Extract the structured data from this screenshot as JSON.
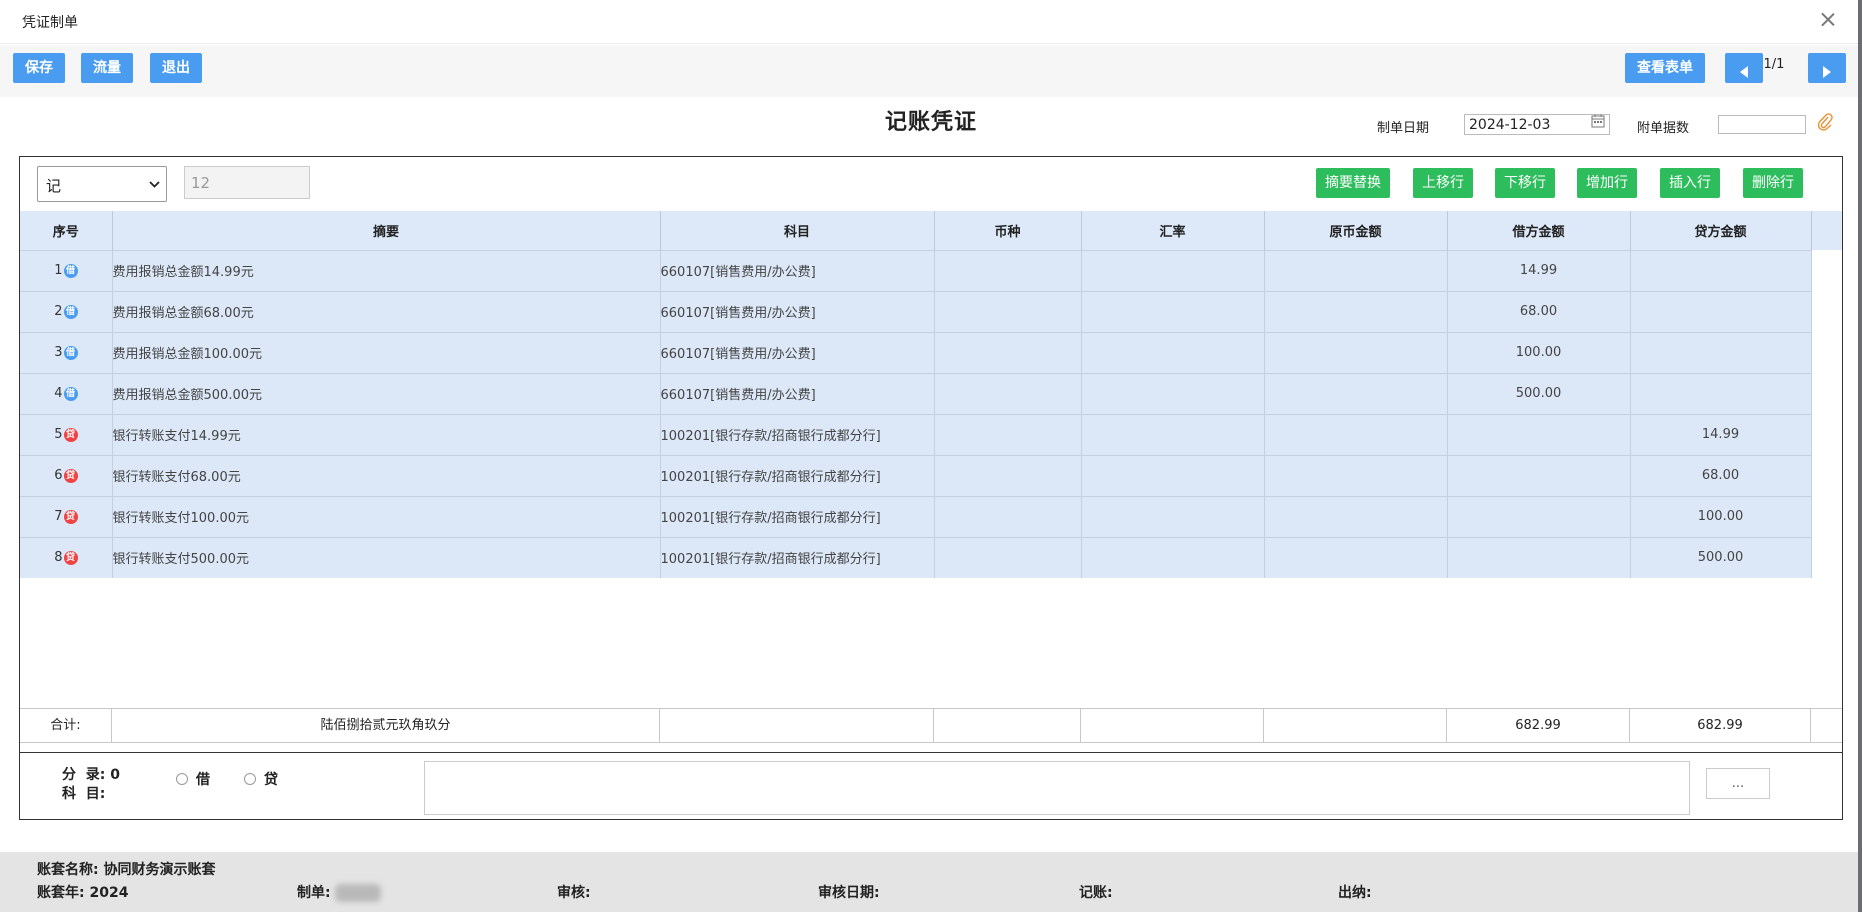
{
  "window": {
    "title": "凭证制单"
  },
  "toolbar": {
    "save": "保存",
    "flow": "流量",
    "exit": "退出",
    "view_sheet": "查看表单",
    "page": "1/1"
  },
  "header": {
    "voucher_title": "记账凭证",
    "date_label": "制单日期",
    "date_value": "2024-12-03",
    "attach_label": "附单据数",
    "attach_value": ""
  },
  "voucher_type": {
    "selected": "记"
  },
  "voucher_number": {
    "placeholder": "12"
  },
  "row_actions": {
    "replace_summary": "摘要替换",
    "move_up": "上移行",
    "move_down": "下移行",
    "add_row": "增加行",
    "insert_row": "插入行",
    "delete_row": "删除行"
  },
  "columns": [
    "序号",
    "摘要",
    "科目",
    "币种",
    "汇率",
    "原币金额",
    "借方金额",
    "贷方金额"
  ],
  "rows": [
    {
      "seq": "1",
      "mark": "借",
      "side": "debit",
      "summary": "费用报销总金额14.99元",
      "account": "660107[销售费用/办公费]",
      "currency": "",
      "rate": "",
      "orig": "",
      "debit": "14.99",
      "credit": ""
    },
    {
      "seq": "2",
      "mark": "借",
      "side": "debit",
      "summary": "费用报销总金额68.00元",
      "account": "660107[销售费用/办公费]",
      "currency": "",
      "rate": "",
      "orig": "",
      "debit": "68.00",
      "credit": ""
    },
    {
      "seq": "3",
      "mark": "借",
      "side": "debit",
      "summary": "费用报销总金额100.00元",
      "account": "660107[销售费用/办公费]",
      "currency": "",
      "rate": "",
      "orig": "",
      "debit": "100.00",
      "credit": ""
    },
    {
      "seq": "4",
      "mark": "借",
      "side": "debit",
      "summary": "费用报销总金额500.00元",
      "account": "660107[销售费用/办公费]",
      "currency": "",
      "rate": "",
      "orig": "",
      "debit": "500.00",
      "credit": ""
    },
    {
      "seq": "5",
      "mark": "贷",
      "side": "credit",
      "summary": "银行转账支付14.99元",
      "account": "100201[银行存款/招商银行成都分行]",
      "currency": "",
      "rate": "",
      "orig": "",
      "debit": "",
      "credit": "14.99"
    },
    {
      "seq": "6",
      "mark": "贷",
      "side": "credit",
      "summary": "银行转账支付68.00元",
      "account": "100201[银行存款/招商银行成都分行]",
      "currency": "",
      "rate": "",
      "orig": "",
      "debit": "",
      "credit": "68.00"
    },
    {
      "seq": "7",
      "mark": "贷",
      "side": "credit",
      "summary": "银行转账支付100.00元",
      "account": "100201[银行存款/招商银行成都分行]",
      "currency": "",
      "rate": "",
      "orig": "",
      "debit": "",
      "credit": "100.00"
    },
    {
      "seq": "8",
      "mark": "贷",
      "side": "credit",
      "summary": "银行转账支付500.00元",
      "account": "100201[银行存款/招商银行成都分行]",
      "currency": "",
      "rate": "",
      "orig": "",
      "debit": "",
      "credit": "500.00"
    }
  ],
  "totals": {
    "label": "合计:",
    "in_words": "陆佰捌拾贰元玖角玖分",
    "debit": "682.99",
    "credit": "682.99"
  },
  "entry": {
    "entry_label": "分  录:",
    "entry_count": "0",
    "subject_label": "科  目:",
    "debit_option": "借",
    "credit_option": "贷",
    "more": "..."
  },
  "footer": {
    "book_name_label": "账套名称:",
    "book_name": "协同财务演示账套",
    "book_year_label": "账套年:",
    "book_year": "2024",
    "maker_label": "制单:",
    "audit_label": "审核:",
    "audit_date_label": "审核日期:",
    "posting_label": "记账:",
    "cashier_label": "出纳:"
  }
}
